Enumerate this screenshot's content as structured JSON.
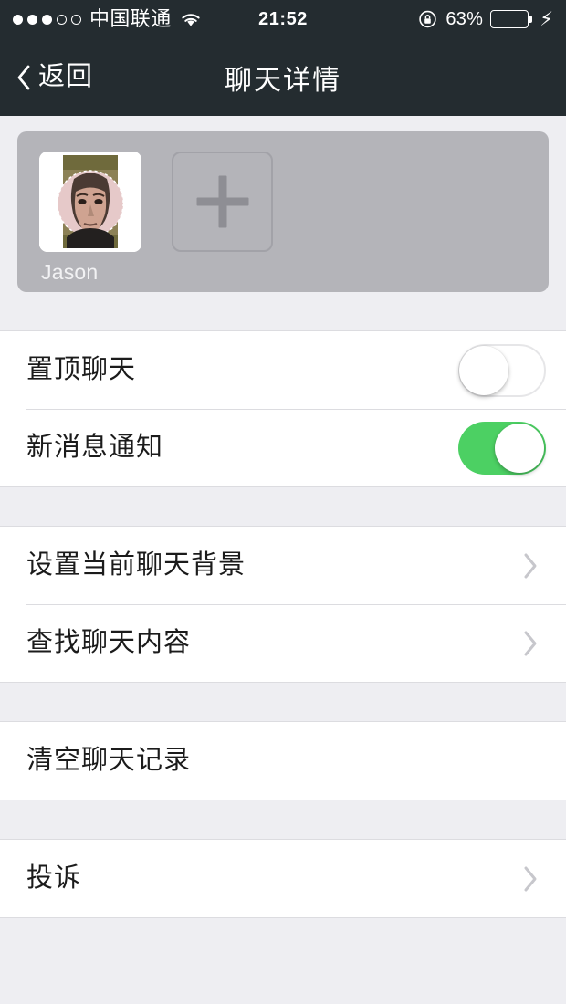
{
  "statusbar": {
    "signal_dots_filled": 3,
    "signal_dots_total": 5,
    "carrier": "中国联通",
    "wifi_icon": "wifi-icon",
    "time": "21:52",
    "rotation_lock_icon": "rotation-lock-icon",
    "battery_percent": "63%",
    "battery_level": 63,
    "battery_icon": "battery-icon",
    "charging_icon": "lightning-bolt-icon",
    "bolt_glyph": "⚡"
  },
  "navbar": {
    "back_label": "返回",
    "back_icon": "chevron-left-icon",
    "title": "聊天详情"
  },
  "members": {
    "people": [
      {
        "name": "Jason",
        "avatar_icon": "avatar-photo"
      }
    ],
    "add_button_label": "+",
    "add_button_icon": "plus-icon"
  },
  "sections": [
    {
      "id": "toggles",
      "rows": [
        {
          "label": "置顶聊天",
          "control": "toggle",
          "toggle_on": false,
          "name": "row-pin-chat"
        },
        {
          "label": "新消息通知",
          "control": "toggle",
          "toggle_on": true,
          "name": "row-new-message-notification"
        }
      ]
    },
    {
      "id": "chat-options",
      "rows": [
        {
          "label": "设置当前聊天背景",
          "control": "chevron",
          "name": "row-set-chat-background"
        },
        {
          "label": "查找聊天内容",
          "control": "chevron",
          "name": "row-search-chat-content"
        }
      ]
    },
    {
      "id": "clear",
      "rows": [
        {
          "label": "清空聊天记录",
          "control": "none",
          "name": "row-clear-chat-history"
        }
      ]
    },
    {
      "id": "complain",
      "rows": [
        {
          "label": "投诉",
          "control": "chevron",
          "name": "row-complain"
        }
      ]
    }
  ],
  "colors": {
    "navbar_bg": "#242c30",
    "page_bg": "#eeeef2",
    "card_bg": "#b4b4b9",
    "toggle_on": "#4cd063",
    "battery_green": "#4cd964",
    "separator": "#dcdce0",
    "text_primary": "#1b1b1b",
    "chevron": "#c7c7cc"
  }
}
